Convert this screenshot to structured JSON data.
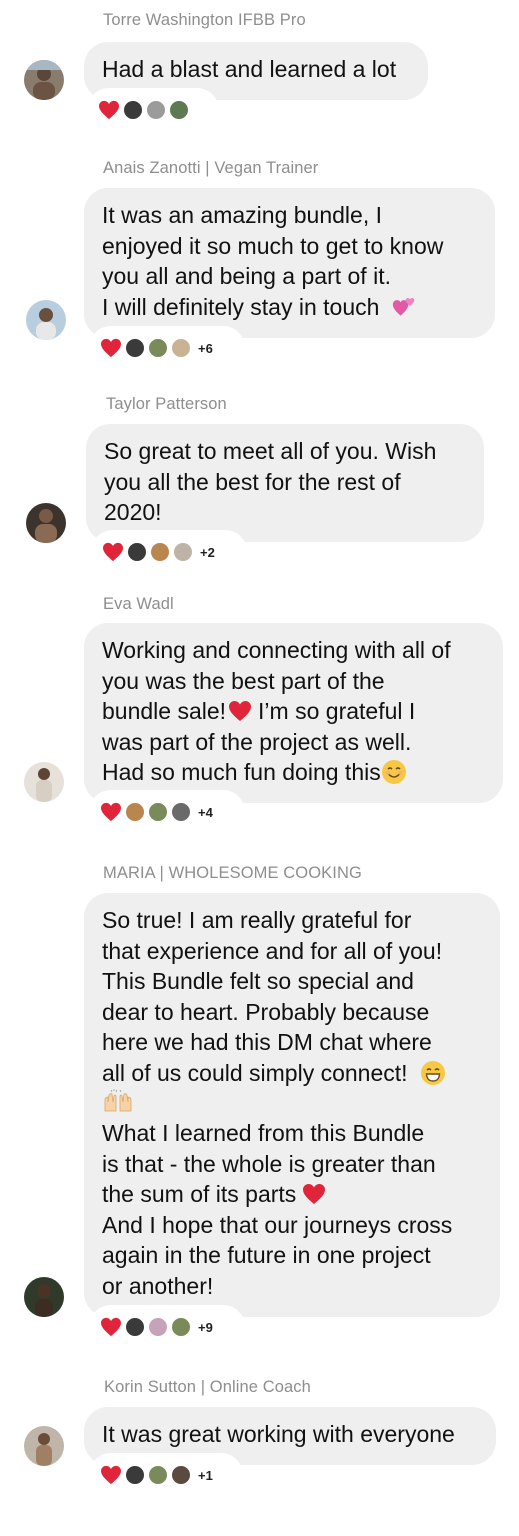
{
  "messages": [
    {
      "sender": "Torre Washington IFBB Pro",
      "lines": [
        "Had a blast and learned a lot"
      ],
      "reaction_count": "",
      "avatar_color": "#7a6a5a"
    },
    {
      "sender": "Anais Zanotti | Vegan Trainer",
      "lines": [
        "It was an amazing bundle, I",
        "enjoyed it so much to get to know",
        "you all and being a part of it.",
        "I will definitely stay in touch"
      ],
      "reaction_count": "+6",
      "avatar_color": "#9bb4c9"
    },
    {
      "sender": "Taylor Patterson",
      "lines": [
        "So great to meet all of you. Wish",
        "you all the best for the rest of",
        "2020!"
      ],
      "reaction_count": "+2",
      "avatar_color": "#5a4a3e"
    },
    {
      "sender": "Eva Wadl",
      "lines": [
        "Working and connecting with all of",
        "you was the best part of the",
        "bundle sale!",
        "I’m so grateful I",
        "was part of the project as well.",
        "Had so much fun doing this"
      ],
      "reaction_count": "+4",
      "avatar_color": "#c9c2b8"
    },
    {
      "sender": "MARIA | WHOLESOME COOKING",
      "lines": [
        "So true! I am really grateful for",
        "that experience and for all of you!",
        "This Bundle felt so special and",
        "dear to heart. Probably because",
        "here we had this DM chat where",
        "all of us could simply connect!",
        "What I learned from this Bundle",
        "is that - the whole is greater than",
        "the sum of its parts",
        "And I hope that our journeys cross",
        "again in the future in one project",
        "or another!"
      ],
      "reaction_count": "+9",
      "avatar_color": "#3e4a3a"
    },
    {
      "sender": "Korin Sutton | Online Coach",
      "lines": [
        "It was great working with everyone"
      ],
      "reaction_count": "+1",
      "avatar_color": "#9a8a78"
    }
  ],
  "colors": {
    "bubble": "#efefef",
    "sender": "#8e8e8e",
    "heart": "#e0243a"
  },
  "icons": [
    "heart-icon",
    "reactor-avatar",
    "sparkling-heart-emoji",
    "red-heart-emoji",
    "smiling-face-emoji",
    "grinning-face-emoji",
    "raising-hands-emoji"
  ]
}
